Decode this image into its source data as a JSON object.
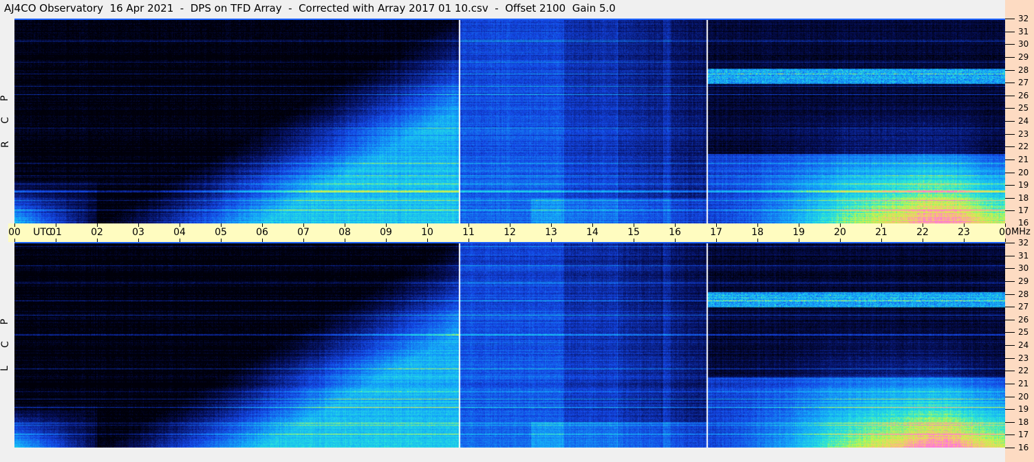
{
  "title": "AJ4CO Observatory  16 Apr 2021  -  DPS on TFD Array  -  Corrected with Array 2017 01 10.csv  -  Offset 2100  Gain 5.0",
  "colors": {
    "panel_border": "#1e64ff",
    "time_axis_bg": "#fffcc0",
    "freq_strip_bg": "#fddbc2",
    "marker_line": "#ffffff"
  },
  "chart_data": [
    {
      "type": "heatmap",
      "panel": "top",
      "polarization_label": [
        "R",
        "C",
        "P"
      ],
      "xlabel": "UTC",
      "ylabel": "MHz",
      "xlim": [
        0,
        24
      ],
      "ylim": [
        16,
        32
      ]
    },
    {
      "type": "heatmap",
      "panel": "bottom",
      "polarization_label": [
        "L",
        "C",
        "P"
      ],
      "xlabel": "UTC",
      "ylabel": "MHz",
      "xlim": [
        0,
        24
      ],
      "ylim": [
        16,
        32
      ]
    }
  ],
  "time_axis": {
    "unit_label": "UTC",
    "ticks": [
      "00",
      "01",
      "02",
      "03",
      "04",
      "05",
      "06",
      "07",
      "08",
      "09",
      "10",
      "11",
      "12",
      "13",
      "14",
      "15",
      "16",
      "17",
      "18",
      "19",
      "20",
      "21",
      "22",
      "23",
      "00"
    ]
  },
  "freq_axis": {
    "unit_label": "MHz",
    "ticks": [
      "16",
      "17",
      "18",
      "19",
      "20",
      "21",
      "22",
      "23",
      "24",
      "25",
      "26",
      "27",
      "28",
      "29",
      "30",
      "31",
      "32"
    ]
  },
  "marker_lines_utc": [
    10.78,
    16.78
  ]
}
